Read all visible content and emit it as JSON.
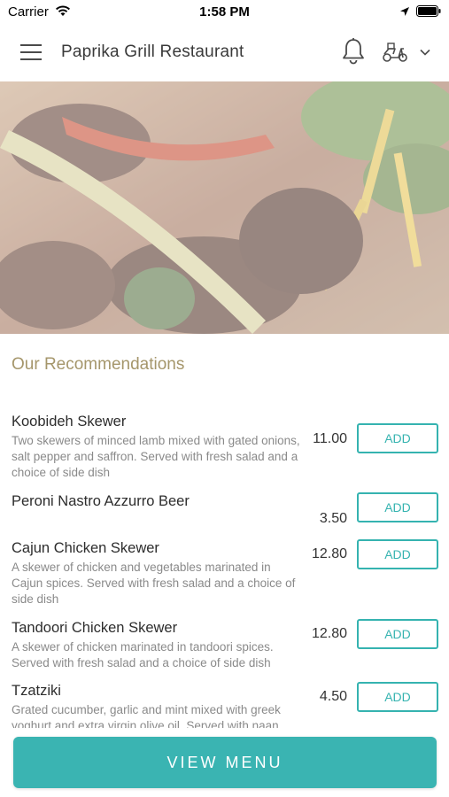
{
  "status_bar": {
    "carrier": "Carrier",
    "time": "1:58 PM"
  },
  "header": {
    "title": "Paprika Grill Restaurant",
    "menu_icon": "hamburger-menu-icon",
    "notification_icon": "bell-icon",
    "order_type_icon": "scooter-icon",
    "dropdown_icon": "chevron-down-icon"
  },
  "hero": {
    "image_subject": "grilled vegetables and meat skewers"
  },
  "recommendations": {
    "title": "Our Recommendations",
    "items": [
      {
        "name": "Koobideh Skewer",
        "description": "Two skewers of minced lamb mixed with gated onions, salt pepper and saffron. Served with fresh salad and a choice of side dish",
        "price": "11.00",
        "add_label": "ADD"
      },
      {
        "name": "Peroni Nastro Azzurro Beer",
        "description": "",
        "price": "3.50",
        "add_label": "ADD"
      },
      {
        "name": "Cajun Chicken Skewer",
        "description": "A skewer of chicken and vegetables marinated in Cajun spices. Served with fresh salad and a choice of side dish",
        "price": "12.80",
        "add_label": "ADD"
      },
      {
        "name": "Tandoori Chicken Skewer",
        "description": "A skewer of chicken marinated in tandoori spices. Served with fresh salad and a choice of side dish",
        "price": "12.80",
        "add_label": "ADD"
      },
      {
        "name": "Tzatziki",
        "description": "Grated cucumber, garlic and mint mixed with greek yoghurt and extra virgin olive oil. Served with naan",
        "price": "4.50",
        "add_label": "ADD"
      }
    ]
  },
  "footer": {
    "view_menu_label": "VIEW MENU"
  },
  "colors": {
    "accent": "#35b3b0",
    "button_fill": "#3ab4b2",
    "section_title": "#a5966b",
    "description_text": "#8a8a8a"
  }
}
